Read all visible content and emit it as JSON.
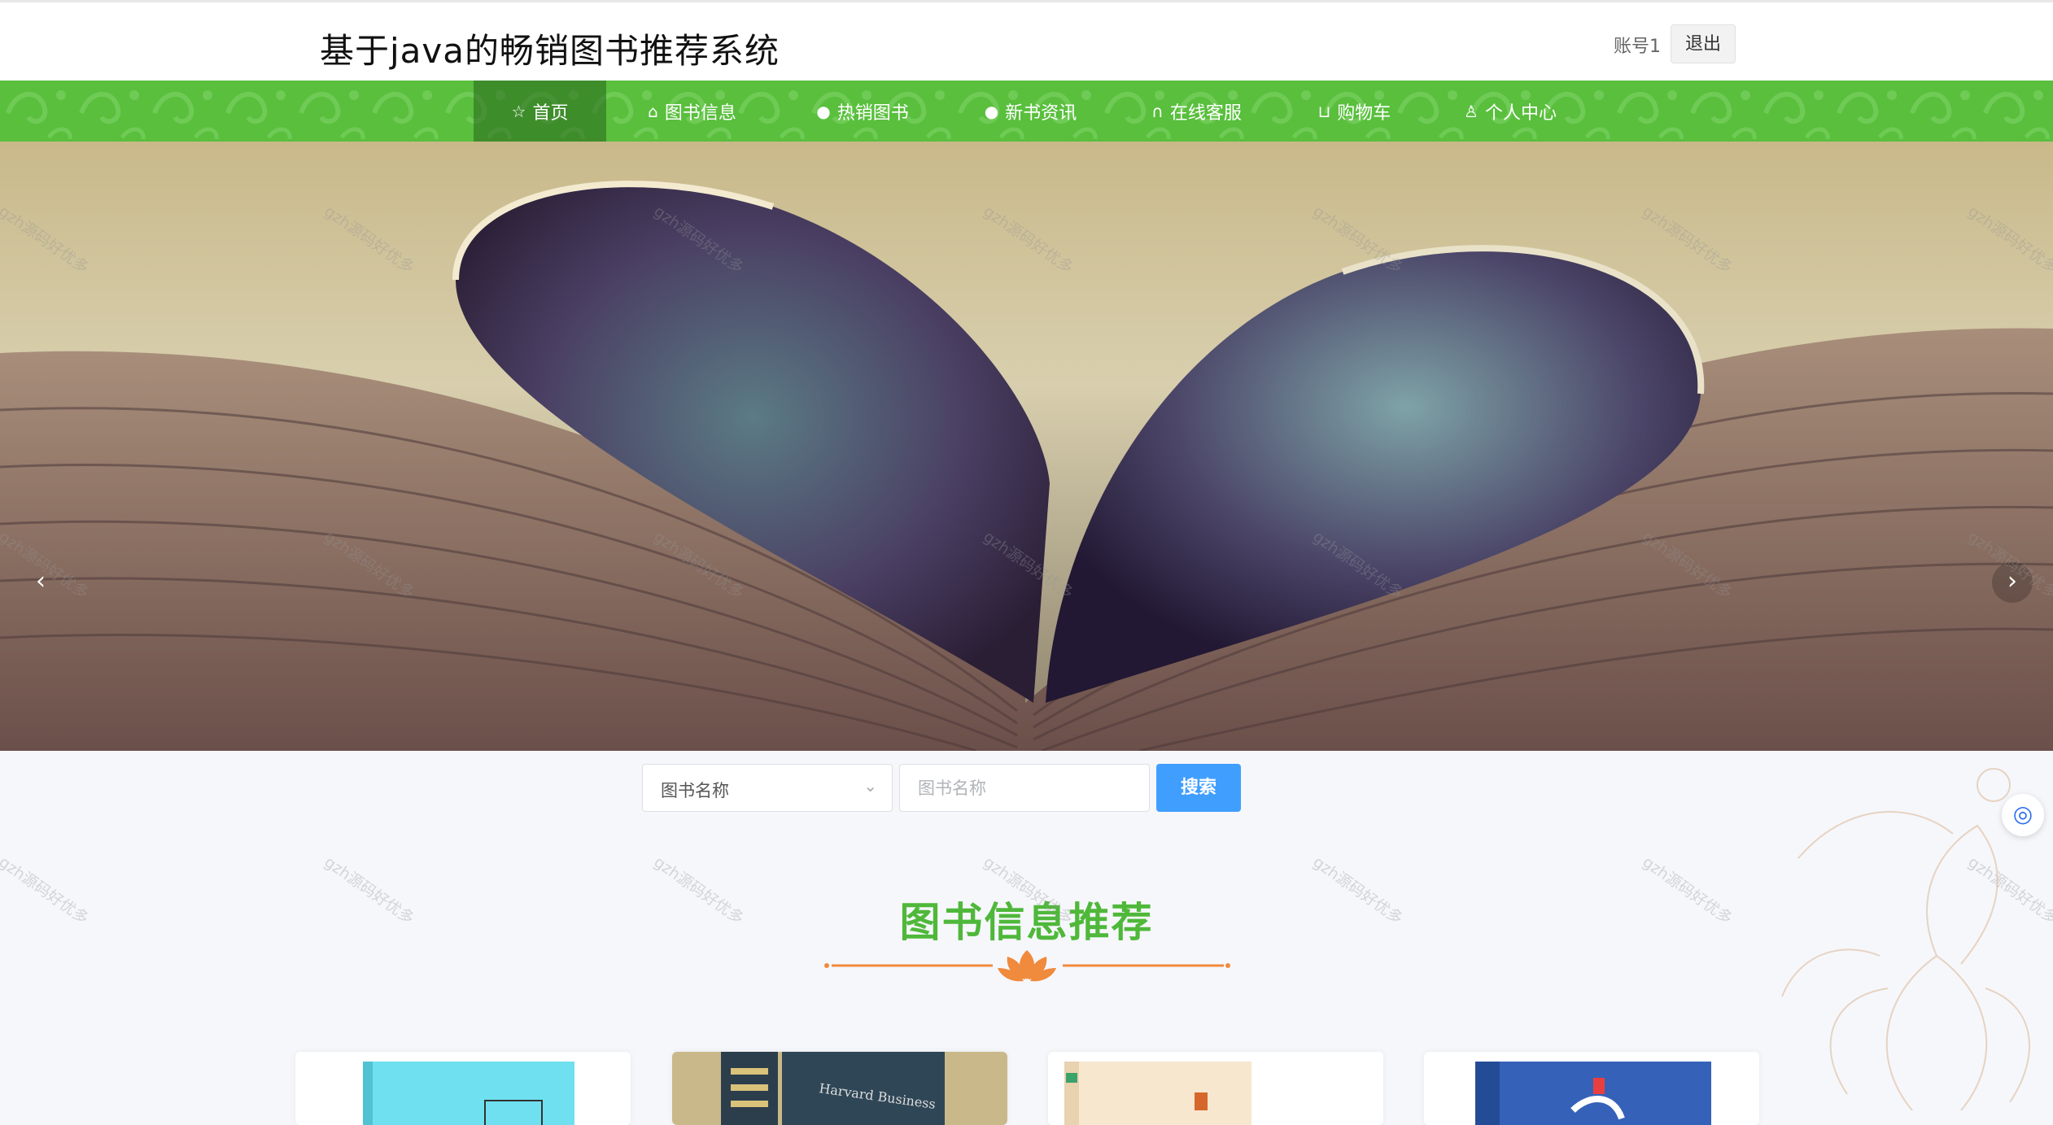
{
  "header": {
    "title": "基于java的畅销图书推荐系统",
    "account": "账号1",
    "logout_label": "退出"
  },
  "nav": {
    "items": [
      {
        "label": "首页",
        "icon": "star-icon",
        "glyph": "☆",
        "active": true
      },
      {
        "label": "图书信息",
        "icon": "bag-icon",
        "glyph": "⌂",
        "active": false
      },
      {
        "label": "热销图书",
        "icon": "alert-icon",
        "glyph": "●",
        "active": false
      },
      {
        "label": "新书资讯",
        "icon": "question-icon",
        "glyph": "●",
        "active": false
      },
      {
        "label": "在线客服",
        "icon": "headset-icon",
        "glyph": "∩",
        "active": false
      },
      {
        "label": "购物车",
        "icon": "cart-icon",
        "glyph": "⊔",
        "active": false
      },
      {
        "label": "个人中心",
        "icon": "user-icon",
        "glyph": "♙",
        "active": false
      }
    ]
  },
  "carousel": {
    "prev_glyph": "‹",
    "next_glyph": "›",
    "slide_count": 3,
    "active_index": 0
  },
  "search": {
    "field_select": "图书名称",
    "input_placeholder": "图书名称",
    "button_label": "搜索"
  },
  "section": {
    "title": "图书信息推荐"
  },
  "watermark": "gzh源码好优多",
  "colors": {
    "nav_green": "#59bf3d",
    "accent_green": "#4fb83a",
    "search_blue": "#409eff",
    "divider_orange": "#f08a3c"
  }
}
